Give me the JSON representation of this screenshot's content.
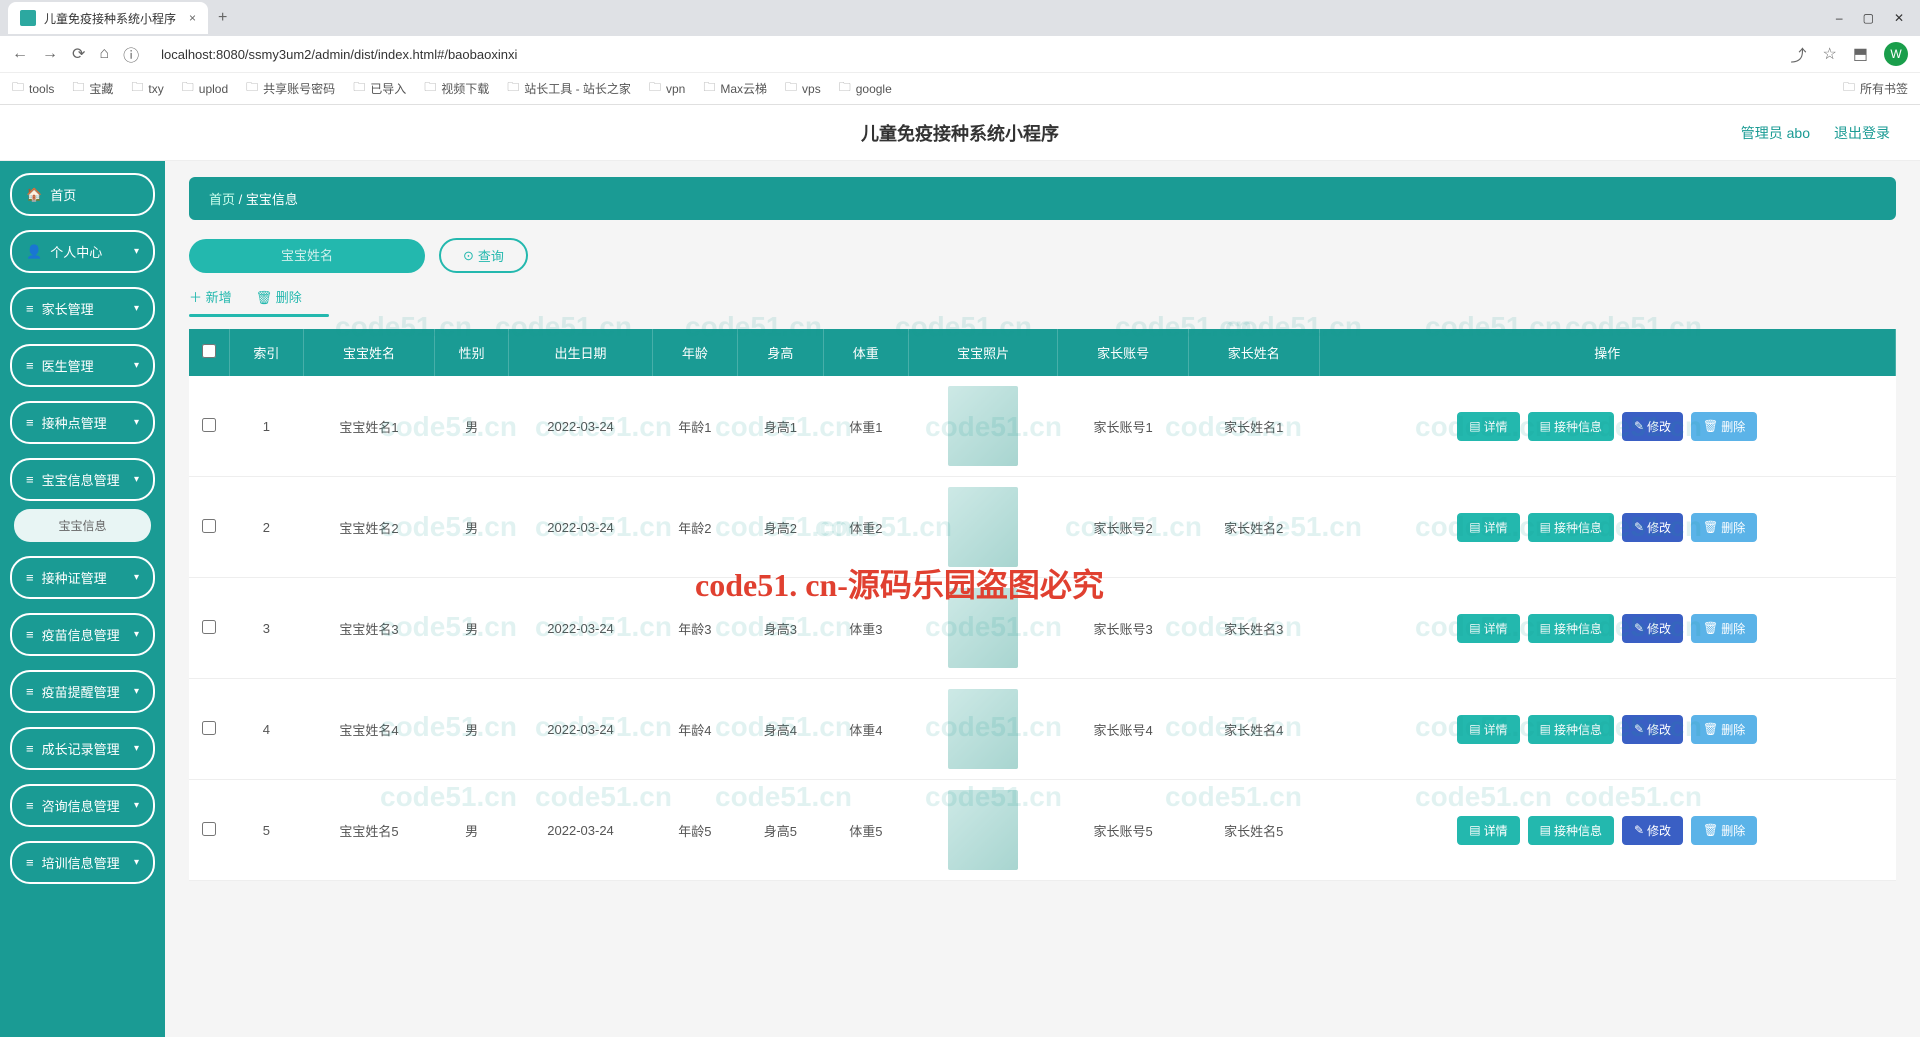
{
  "browser": {
    "tab_title": "儿童免疫接种系统小程序",
    "url": "localhost:8080/ssmy3um2/admin/dist/index.html#/baobaoxinxi",
    "profile_letter": "W",
    "all_bookmarks": "所有书签",
    "bookmarks": [
      "tools",
      "宝藏",
      "txy",
      "uplod",
      "共享账号密码",
      "已导入",
      "视频下载",
      "站长工具 - 站长之家",
      "vpn",
      "Max云梯",
      "vps",
      "google"
    ]
  },
  "header": {
    "title": "儿童免疫接种系统小程序",
    "admin_label": "管理员 abo",
    "logout": "退出登录"
  },
  "sidebar": {
    "items": [
      {
        "icon": "🏠",
        "label": "首页",
        "chev": false
      },
      {
        "icon": "👤",
        "label": "个人中心",
        "chev": true
      },
      {
        "icon": "≡",
        "label": "家长管理",
        "chev": true
      },
      {
        "icon": "≡",
        "label": "医生管理",
        "chev": true
      },
      {
        "icon": "≡",
        "label": "接种点管理",
        "chev": true
      },
      {
        "icon": "≡",
        "label": "宝宝信息管理",
        "chev": true
      },
      {
        "icon": "≡",
        "label": "接种证管理",
        "chev": true
      },
      {
        "icon": "≡",
        "label": "疫苗信息管理",
        "chev": true
      },
      {
        "icon": "≡",
        "label": "疫苗提醒管理",
        "chev": true
      },
      {
        "icon": "≡",
        "label": "成长记录管理",
        "chev": true
      },
      {
        "icon": "≡",
        "label": "咨询信息管理",
        "chev": true
      },
      {
        "icon": "≡",
        "label": "培训信息管理",
        "chev": true
      }
    ],
    "active_sub": "宝宝信息"
  },
  "breadcrumb": {
    "home": "首页",
    "sep": "/",
    "current": "宝宝信息"
  },
  "toolbar": {
    "search_placeholder": "宝宝姓名",
    "search_btn": "查询",
    "add": "新增",
    "delete": "删除"
  },
  "table": {
    "headers": [
      "",
      "索引",
      "宝宝姓名",
      "性别",
      "出生日期",
      "年龄",
      "身高",
      "体重",
      "宝宝照片",
      "家长账号",
      "家长姓名",
      "操作"
    ],
    "action_labels": {
      "detail": "详情",
      "vaccine": "接种信息",
      "edit": "修改",
      "delete": "删除"
    },
    "rows": [
      {
        "idx": "1",
        "name": "宝宝姓名1",
        "gender": "男",
        "dob": "2022-03-24",
        "age": "年龄1",
        "height": "身高1",
        "weight": "体重1",
        "acct": "家长账号1",
        "pname": "家长姓名1"
      },
      {
        "idx": "2",
        "name": "宝宝姓名2",
        "gender": "男",
        "dob": "2022-03-24",
        "age": "年龄2",
        "height": "身高2",
        "weight": "体重2",
        "acct": "家长账号2",
        "pname": "家长姓名2"
      },
      {
        "idx": "3",
        "name": "宝宝姓名3",
        "gender": "男",
        "dob": "2022-03-24",
        "age": "年龄3",
        "height": "身高3",
        "weight": "体重3",
        "acct": "家长账号3",
        "pname": "家长姓名3"
      },
      {
        "idx": "4",
        "name": "宝宝姓名4",
        "gender": "男",
        "dob": "2022-03-24",
        "age": "年龄4",
        "height": "身高4",
        "weight": "体重4",
        "acct": "家长账号4",
        "pname": "家长姓名4"
      },
      {
        "idx": "5",
        "name": "宝宝姓名5",
        "gender": "男",
        "dob": "2022-03-24",
        "age": "年龄5",
        "height": "身高5",
        "weight": "体重5",
        "acct": "家长账号5",
        "pname": "家长姓名5"
      }
    ]
  },
  "watermark_text": "code51.cn",
  "overlay": "code51. cn-源码乐园盗图必究"
}
